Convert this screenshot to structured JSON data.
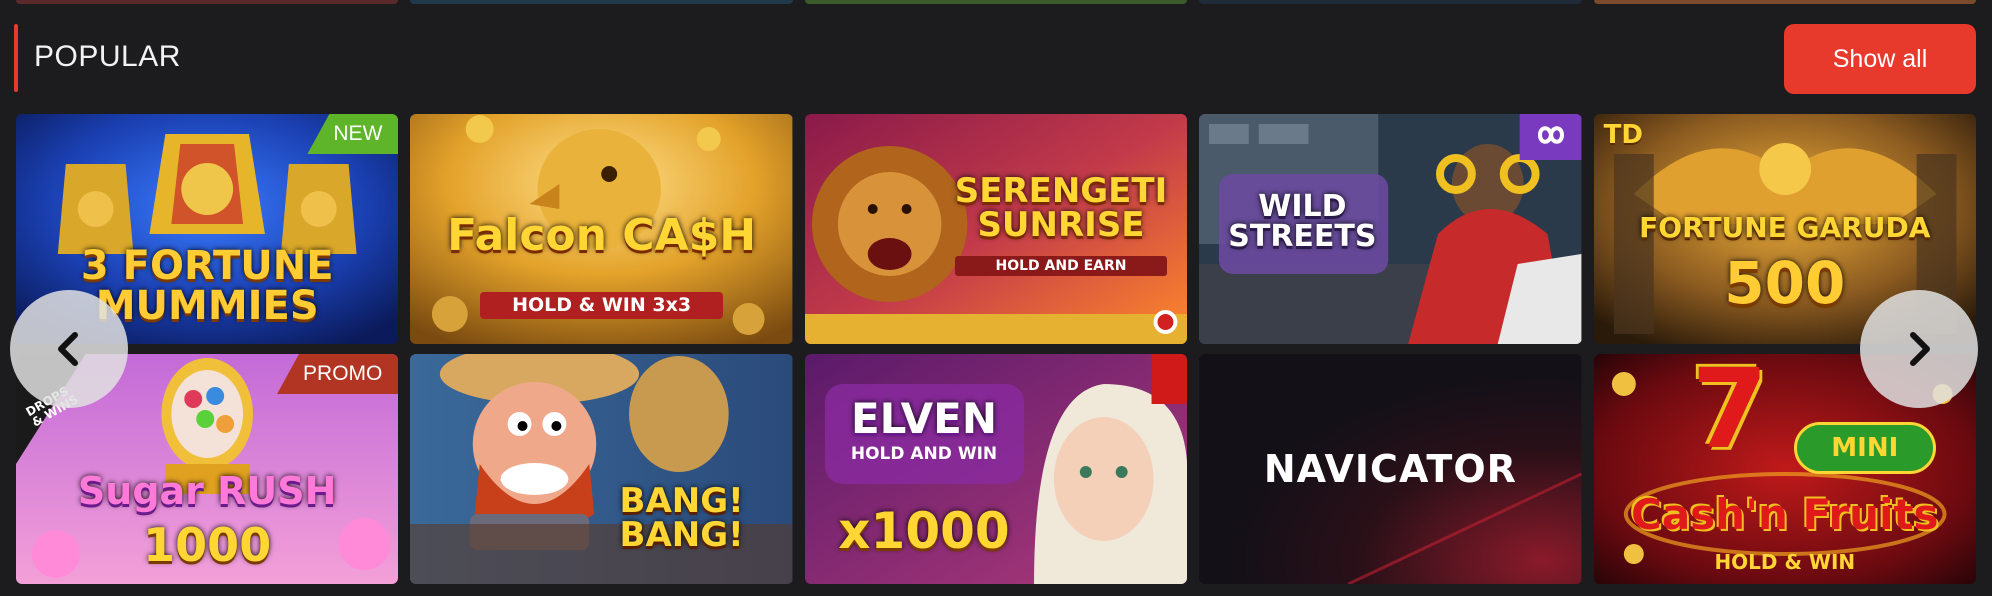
{
  "section": {
    "title": "POPULAR",
    "show_all_label": "Show all"
  },
  "colors": {
    "accent": "#e63a2e",
    "background": "#1c1c1e",
    "badge_new": "#5eb52a",
    "badge_promo": "#b23422"
  },
  "games": [
    {
      "title_lines": [
        "3 FORTUNE",
        "MUMMIES"
      ],
      "badge": "NEW"
    },
    {
      "title_lines": [
        "Falcon CA$H",
        "HOLD & WIN 3x3"
      ],
      "badge": ""
    },
    {
      "title_lines": [
        "SERENGETI",
        "SUNRISE",
        "HOLD AND EARN"
      ],
      "badge": ""
    },
    {
      "title_lines": [
        "WILD",
        "STREETS"
      ],
      "badge": ""
    },
    {
      "title_lines": [
        "TD",
        "FORTUNE GARUDA",
        "500"
      ],
      "badge": ""
    },
    {
      "title_lines": [
        "Sugar RUSH",
        "1000"
      ],
      "badge": "PROMO",
      "corner": "DROPS & WINS"
    },
    {
      "title_lines": [
        "BANG!",
        "BANG!"
      ],
      "badge": ""
    },
    {
      "title_lines": [
        "ELVEN",
        "HOLD AND WIN",
        "x1000"
      ],
      "badge": ""
    },
    {
      "title_lines": [
        "NAVICATOR"
      ],
      "badge": ""
    },
    {
      "title_lines": [
        "7",
        "MINI",
        "Cash'n Fruits",
        "HOLD & WIN"
      ],
      "badge": ""
    }
  ],
  "icons": {
    "prev": "chevron-left-icon",
    "next": "chevron-right-icon",
    "provider": "infinity-icon"
  }
}
